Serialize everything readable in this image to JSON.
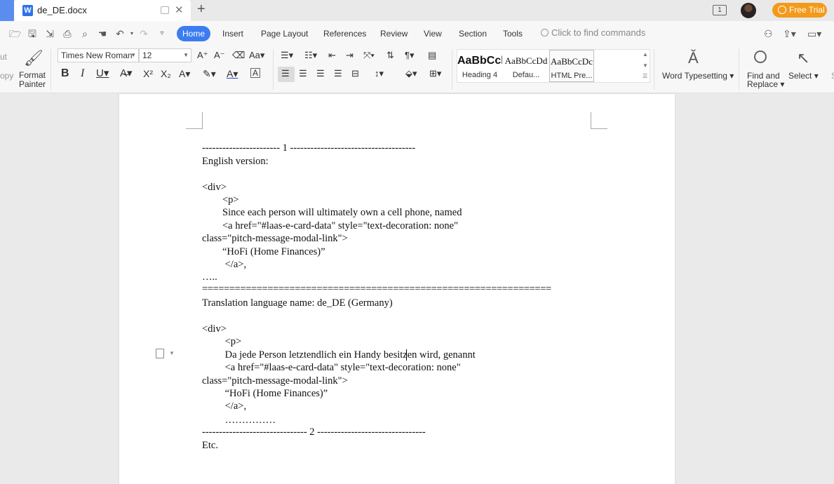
{
  "titlebar": {
    "doc_title": "de_DE.docx",
    "doc_icon_letter": "W",
    "window_indicator": "1",
    "free_trial": "Free Trial"
  },
  "menu": {
    "items": [
      "Home",
      "Insert",
      "Page Layout",
      "References",
      "Review",
      "View",
      "Section",
      "Tools"
    ],
    "find_commands": "Click to find commands"
  },
  "ribbon": {
    "clipboard_partial_top": "ut",
    "clipboard_partial_bottom": "opy",
    "format_painter_line1": "Format",
    "format_painter_line2": "Painter",
    "font_name": "Times New Roman",
    "font_size": "12",
    "styles": [
      {
        "preview": "AaBbCcl",
        "name": "Heading 4"
      },
      {
        "preview": "AaBbCcDd",
        "name": "Defau..."
      },
      {
        "preview": "AaBbCcDc",
        "name": "HTML Pre..."
      }
    ],
    "word_typesetting": "Word Typesetting",
    "find_replace_line1": "Find and",
    "find_replace_line2": "Replace",
    "select": "Select",
    "partial_right": "S"
  },
  "document": {
    "lines": [
      "----------------------- 1 -------------------------------------",
      "English version:",
      "",
      "<div>",
      "        <p>",
      "        Since each person will ultimately own a cell phone, named",
      "        <a href=\"#laas-e-card-data\" style=\"text-decoration: none\"",
      "class=\"pitch-message-modal-link\">",
      "        “HoFi (Home Finances)”",
      "         </a>,",
      "…..",
      "================================================================",
      "Translation language name: de_DE (Germany)",
      "",
      "<div>",
      "         <p>",
      "         Da jede Person letztendlich ein Handy besitzen wird, genannt",
      "         <a href=\"#laas-e-card-data\" style=\"text-decoration: none\"",
      "class=\"pitch-message-modal-link\">",
      "         “HoFi (Home Finances)”",
      "         </a>,",
      "         ……………",
      "------------------------------- 2 --------------------------------",
      "Etc."
    ]
  }
}
